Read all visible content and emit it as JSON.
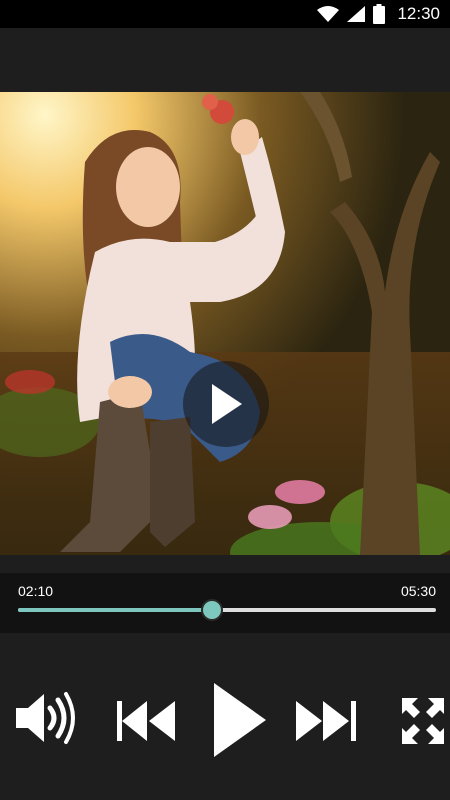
{
  "status_bar": {
    "time": "12:30",
    "icons": [
      "wifi-icon",
      "cellular-signal-icon",
      "battery-icon"
    ]
  },
  "player": {
    "current_time": "02:10",
    "total_time": "05:30",
    "progress_fraction": 0.464,
    "accent_color": "#7ec7be",
    "controls": [
      "volume-icon",
      "previous-icon",
      "play-icon",
      "next-icon",
      "fullscreen-icon"
    ]
  }
}
